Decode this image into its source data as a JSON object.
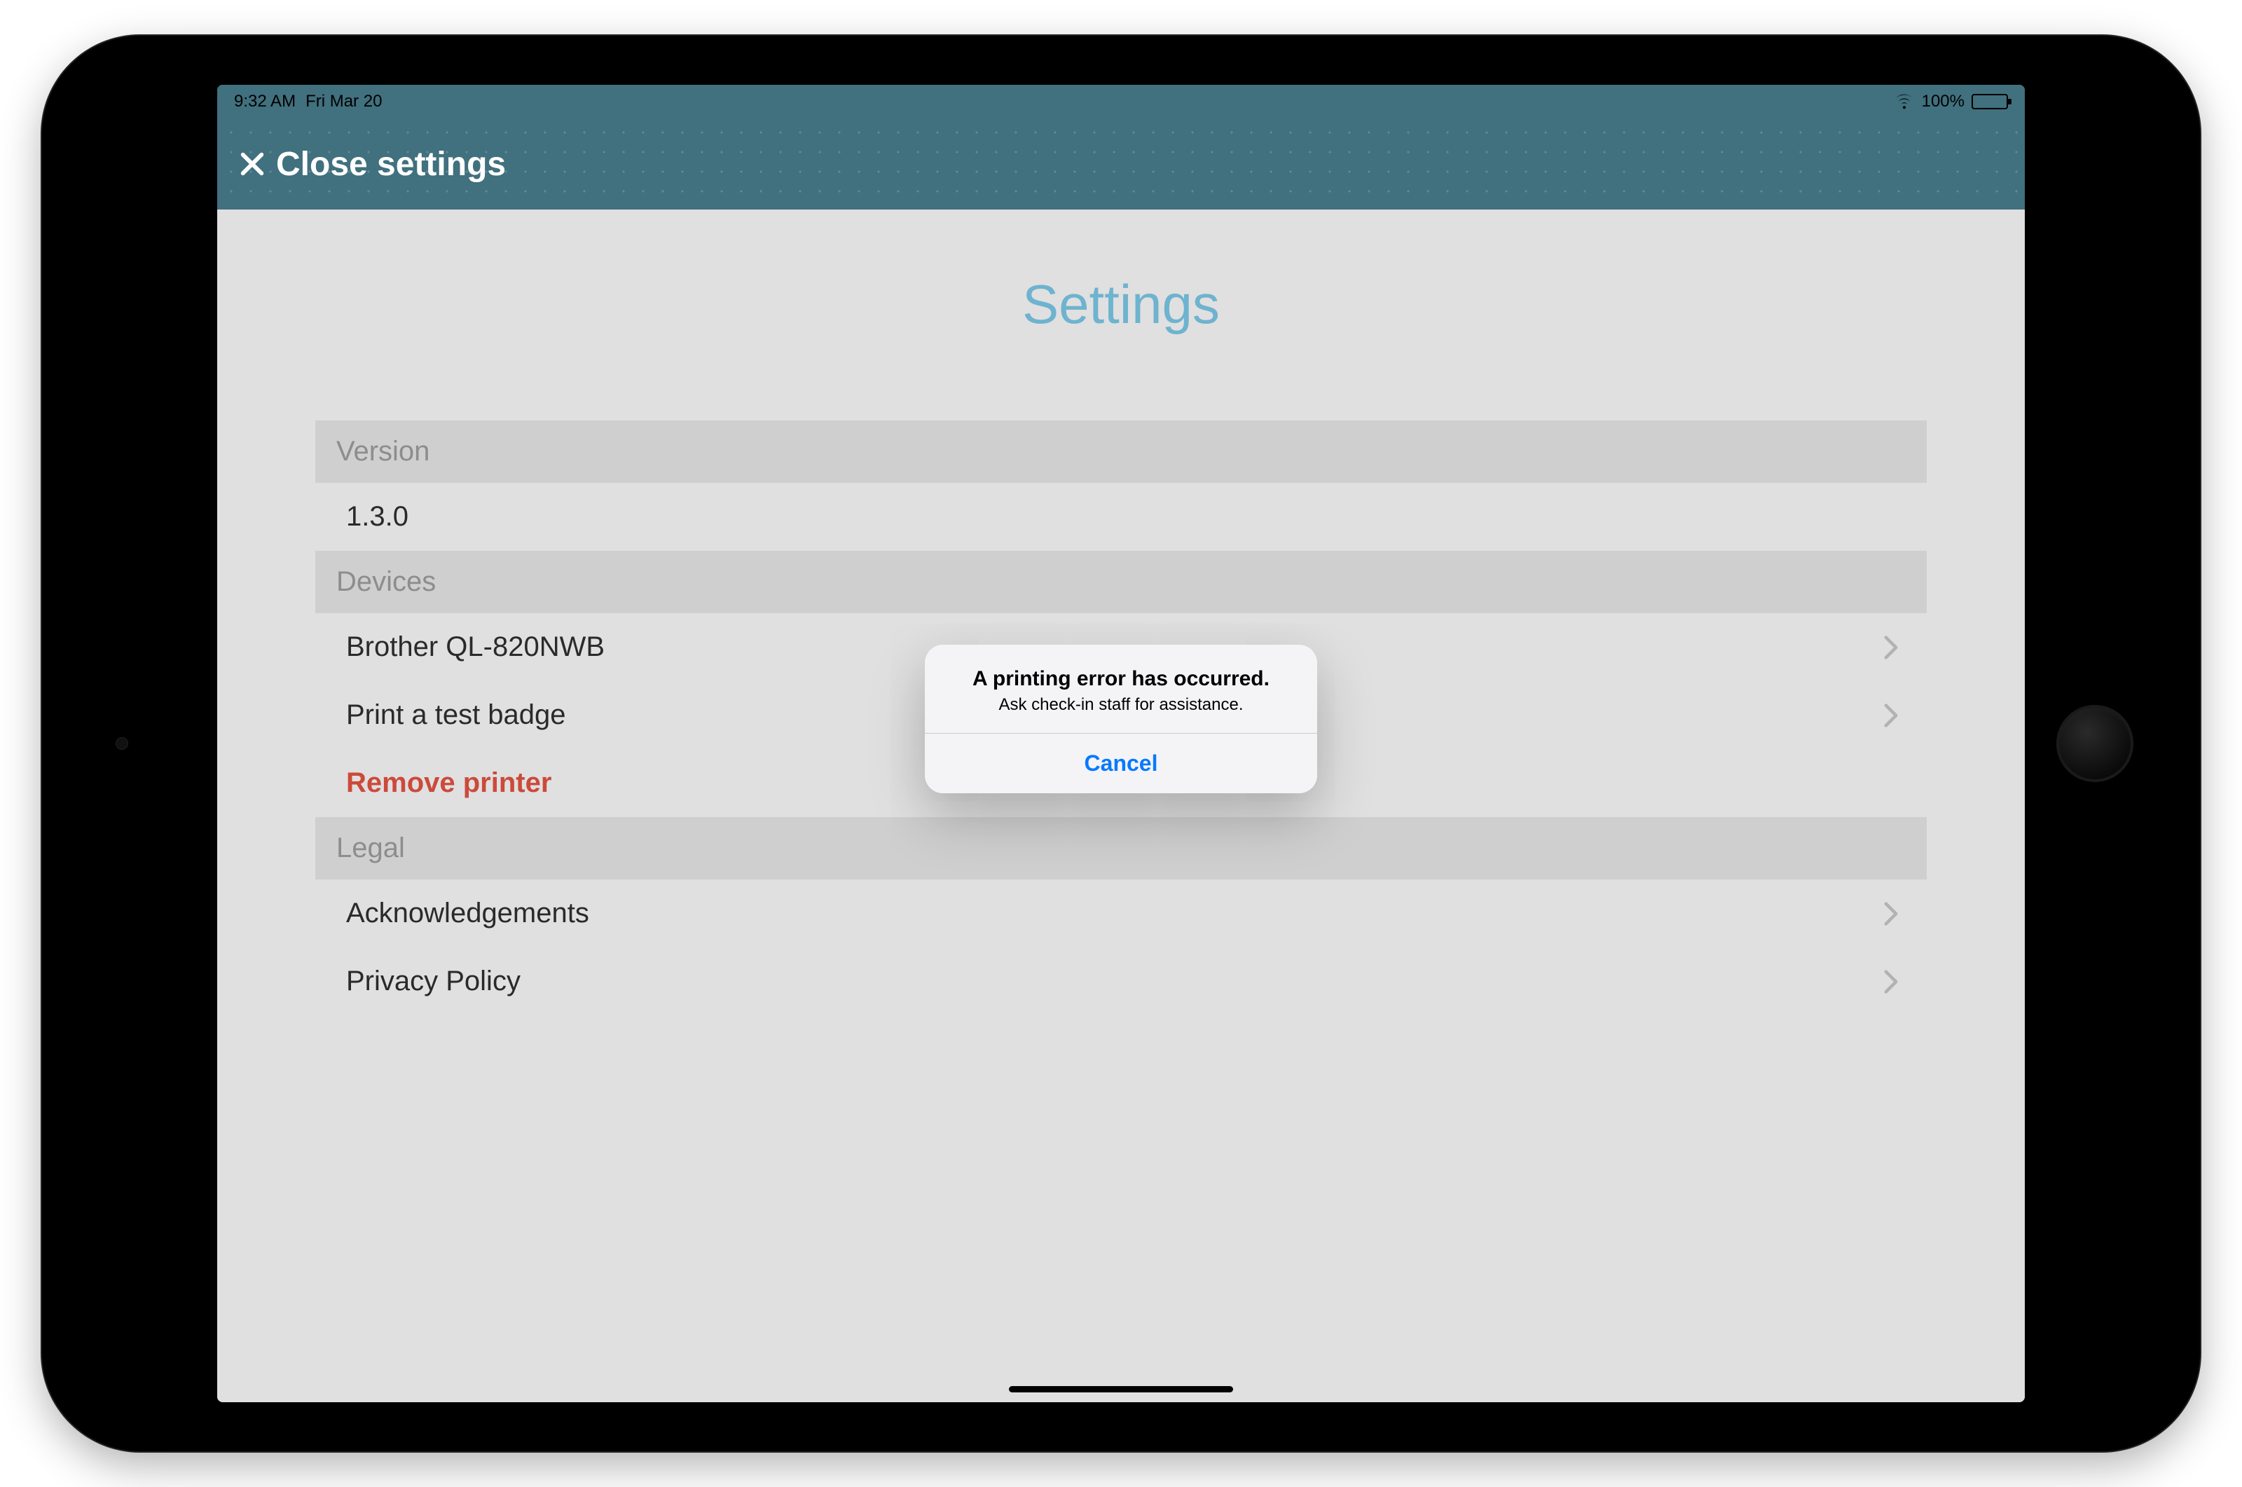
{
  "status_bar": {
    "time": "9:32 AM",
    "date": "Fri Mar 20",
    "battery_pct": "100%"
  },
  "nav": {
    "close_label": "Close settings"
  },
  "page": {
    "title": "Settings"
  },
  "sections": {
    "version": {
      "header": "Version",
      "value": "1.3.0"
    },
    "devices": {
      "header": "Devices",
      "printer": "Brother QL-820NWB",
      "test_badge": "Print a test badge",
      "remove": "Remove printer"
    },
    "legal": {
      "header": "Legal",
      "ack": "Acknowledgements",
      "privacy": "Privacy Policy"
    }
  },
  "alert": {
    "title": "A printing error has occurred.",
    "message": "Ask check-in staff for assistance.",
    "cancel": "Cancel"
  },
  "colors": {
    "accent": "#6eb3cf",
    "navbar": "#41707e",
    "danger": "#cc4a3a",
    "ios_blue": "#0879ff"
  }
}
